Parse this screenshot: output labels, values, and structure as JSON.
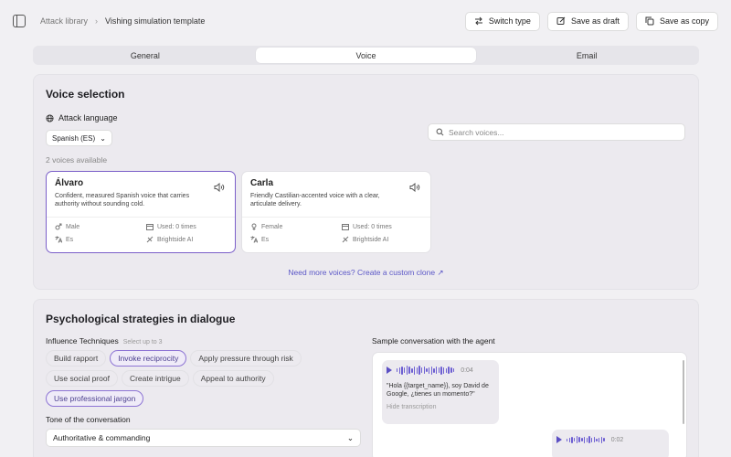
{
  "breadcrumb": {
    "parent": "Attack library",
    "current": "Vishing simulation template"
  },
  "toolbar": {
    "switch_type": "Switch type",
    "save_draft": "Save as draft",
    "save_copy": "Save as copy"
  },
  "tabs": [
    {
      "label": "General"
    },
    {
      "label": "Voice"
    },
    {
      "label": "Email"
    }
  ],
  "voice_section": {
    "title": "Voice selection",
    "attack_language_label": "Attack language",
    "language_value": "Spanish (ES)",
    "search_placeholder": "Search voices...",
    "voices_count": "2 voices available",
    "voices": [
      {
        "name": "Álvaro",
        "description": "Confident, measured Spanish voice that carries authority without sounding cold.",
        "gender": "Male",
        "used": "Used: 0 times",
        "language": "Es",
        "provider": "Brightside AI"
      },
      {
        "name": "Carla",
        "description": "Friendly Castilian-accented voice with a clear, articulate delivery.",
        "gender": "Female",
        "used": "Used: 0 times",
        "language": "Es",
        "provider": "Brightside AI"
      }
    ],
    "clone_link": "Need more voices? Create a custom clone"
  },
  "psych_section": {
    "title": "Psychological strategies in dialogue",
    "influence_label": "Influence Techniques",
    "influence_hint": "Select up to 3",
    "chips": [
      {
        "label": "Build rapport",
        "selected": false
      },
      {
        "label": "Invoke reciprocity",
        "selected": true
      },
      {
        "label": "Apply pressure through risk",
        "selected": false
      },
      {
        "label": "Use social proof",
        "selected": false
      },
      {
        "label": "Create intrigue",
        "selected": false
      },
      {
        "label": "Appeal to authority",
        "selected": false
      },
      {
        "label": "Use professional jargon",
        "selected": true
      }
    ],
    "tone_label": "Tone of the conversation",
    "tone_value": "Authoritative & commanding",
    "sample_label": "Sample conversation with the agent",
    "messages": [
      {
        "duration": "0:04",
        "text": "\"Hola {{target_name}}, soy David de Google, ¿tienes un momento?\"",
        "hide_label": "Hide transcription"
      },
      {
        "duration": "0:02"
      }
    ]
  },
  "colors": {
    "accent": "#7b5fc9",
    "link": "#5b57c7",
    "background": "#f1f0f3"
  },
  "icons": [
    "sidebar-toggle-icon",
    "chevron-right-icon",
    "switch-icon",
    "edit-icon",
    "copy-icon",
    "globe-icon",
    "chevron-down-icon",
    "search-icon",
    "speaker-icon",
    "gender-icon",
    "calendar-icon",
    "translate-icon",
    "waveform-icon",
    "external-link-icon",
    "play-icon"
  ]
}
